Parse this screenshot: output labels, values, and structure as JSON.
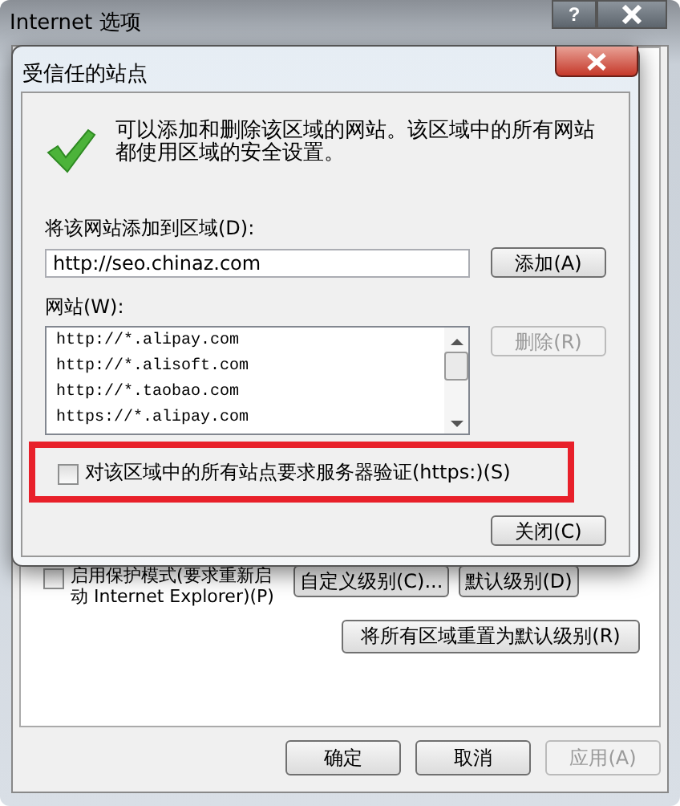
{
  "window": {
    "title": "Internet 选项",
    "help_button": "?"
  },
  "background": {
    "protected_mode": {
      "label": "启用保护模式(要求重新启动 Internet Explorer)(P)",
      "checked": false
    },
    "level_buttons": [
      "自定义级别(C)...",
      "默认级别(D)"
    ],
    "reset_button": "将所有区域重置为默认级别(R)",
    "footer_buttons": [
      {
        "label": "确定",
        "disabled": false
      },
      {
        "label": "取消",
        "disabled": false
      },
      {
        "label": "应用(A)",
        "disabled": true
      }
    ]
  },
  "dialog": {
    "title": "受信任的站点",
    "description": "可以添加和删除该区域的网站。该区域中的所有网站都使用区域的安全设置。",
    "add_label": "将该网站添加到区域(D):",
    "url_value": "http://seo.chinaz.com",
    "add_button": "添加(A)",
    "sites_label": "网站(W):",
    "sites": [
      "http://*.alipay.com",
      "http://*.alisoft.com",
      "http://*.taobao.com",
      "https://*.alipay.com"
    ],
    "remove_button": {
      "label": "删除(R)",
      "disabled": true
    },
    "require_https": {
      "label": "对该区域中的所有站点要求服务器验证(https:)(S)",
      "checked": false
    },
    "close_button": "关闭(C)"
  }
}
